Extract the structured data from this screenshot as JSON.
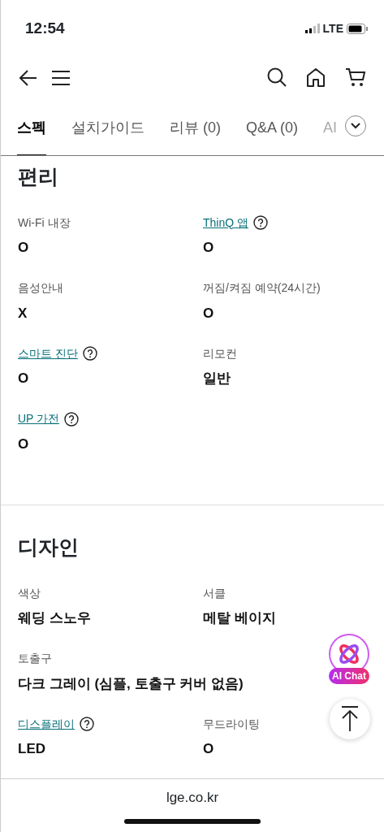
{
  "status_bar": {
    "time": "12:54",
    "network": "LTE"
  },
  "tabs": [
    {
      "label": "스펙",
      "selected": true
    },
    {
      "label": "설치가이드",
      "selected": false
    },
    {
      "label": "리뷰 (0)",
      "selected": false
    },
    {
      "label": "Q&A (0)",
      "selected": false
    },
    {
      "label": "AI",
      "selected": false
    }
  ],
  "sections": [
    {
      "title": "편리",
      "specs": [
        {
          "label": "Wi-Fi 내장",
          "value": "O",
          "link": false,
          "wide": false
        },
        {
          "label": "ThinQ 앱",
          "value": "O",
          "link": true,
          "wide": false
        },
        {
          "label": "음성안내",
          "value": "X",
          "link": false,
          "wide": false
        },
        {
          "label": "꺼짐/켜짐 예약(24시간)",
          "value": "O",
          "link": false,
          "wide": false
        },
        {
          "label": "스마트 진단",
          "value": "O",
          "link": true,
          "wide": false
        },
        {
          "label": "리모컨",
          "value": "일반",
          "link": false,
          "wide": false
        },
        {
          "label": "UP 가전",
          "value": "O",
          "link": true,
          "wide": false
        }
      ]
    },
    {
      "title": "디자인",
      "specs": [
        {
          "label": "색상",
          "value": "웨딩 스노우",
          "link": false,
          "wide": false
        },
        {
          "label": "서클",
          "value": "메탈 베이지",
          "link": false,
          "wide": false
        },
        {
          "label": "토출구",
          "value": "다크 그레이 (심플, 토출구 커버 없음)",
          "link": false,
          "wide": true
        },
        {
          "label": "디스플레이",
          "value": "LED",
          "link": true,
          "wide": false
        },
        {
          "label": "무드라이팅",
          "value": "O",
          "link": false,
          "wide": false
        }
      ]
    }
  ],
  "ai_chat": {
    "label": "AI Chat"
  },
  "url_bar": {
    "address": "lge.co.kr"
  }
}
